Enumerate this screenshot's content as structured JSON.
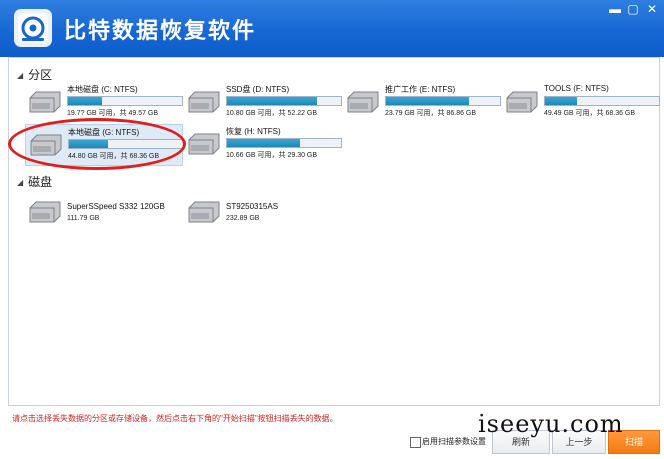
{
  "app": {
    "title": "比特数据恢复软件",
    "window_controls": [
      "▬",
      "▢",
      "✕"
    ],
    "logo_icon": "drive-recovery-logo-icon"
  },
  "partitions_section": {
    "label": "分区",
    "items": [
      {
        "name": "本地磁盘 (C: NTFS)",
        "info": "19.7? GB 可用，共 49.57 GB",
        "used_fraction": 0.3,
        "selected": false
      },
      {
        "name": "SSD盘 (D: NTFS)",
        "info": "10.80 GB 可用，共 52.22 GB",
        "used_fraction": 0.79,
        "selected": false
      },
      {
        "name": "推广工作 (E: NTFS)",
        "info": "23.79 GB 可用，共 86.86 GB",
        "used_fraction": 0.73,
        "selected": false
      },
      {
        "name": "TOOLS (F: NTFS)",
        "info": "49.49 GB 可用，共 68.36 GB",
        "used_fraction": 0.28,
        "selected": false
      },
      {
        "name": "本地磁盘 (G: NTFS)",
        "info": "44.80 GB 可用，共 68.36 GB",
        "used_fraction": 0.34,
        "selected": true
      },
      {
        "name": "恢复 (H: NTFS)",
        "info": "10.66 GB 可用，共 29.30 GB",
        "used_fraction": 0.64,
        "selected": false
      }
    ]
  },
  "disks_section": {
    "label": "磁盘",
    "items": [
      {
        "name": "SuperSSpeed S332 120GB",
        "info": "111.79 GB"
      },
      {
        "name": "ST9250315AS",
        "info": "232.89 GB"
      }
    ]
  },
  "footer": {
    "hint": "请点击选择丢失数据的分区或存储设备，然后点击右下角的\"开始扫描\"按钮扫描丢失的数据。",
    "checkbox_label": "启用扫描参数设置",
    "refresh_label": "刷新",
    "prev_label": "上一步",
    "scan_label": "扫描"
  },
  "watermark": "iseeyu.com",
  "colors": {
    "title_bar": "#1566d3",
    "accent_orange": "#f47b12",
    "highlight": "#e01e1e",
    "bar_fill": "#1d88b8"
  }
}
